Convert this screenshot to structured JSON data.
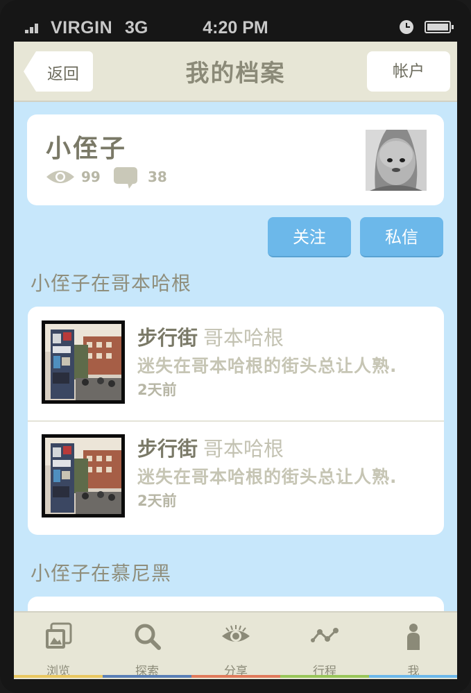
{
  "status_bar": {
    "carrier": "VIRGIN",
    "network": "3G",
    "time": "4:20 PM"
  },
  "nav": {
    "back_label": "返回",
    "title": "我的档案",
    "account_label": "帐户"
  },
  "profile": {
    "name": "小侄子",
    "views": "99",
    "comments": "38"
  },
  "actions": {
    "follow_label": "关注",
    "message_label": "私信"
  },
  "sections": [
    {
      "title": "小侄子在哥本哈根",
      "items": [
        {
          "street": "步行街",
          "city": "哥本哈根",
          "description": "迷失在哥本哈根的街头总让人熟.",
          "time_ago": "2天前"
        },
        {
          "street": "步行街",
          "city": "哥本哈根",
          "description": "迷失在哥本哈根的街头总让人熟.",
          "time_ago": "2天前"
        }
      ]
    },
    {
      "title": "小侄子在慕尼黑",
      "items": []
    }
  ],
  "tabs": [
    {
      "label": "浏览",
      "icon": "photos-icon",
      "color": "#e9c760"
    },
    {
      "label": "探索",
      "icon": "search-icon",
      "color": "#5a7fb6"
    },
    {
      "label": "分享",
      "icon": "eye-icon",
      "color": "#e07a5b"
    },
    {
      "label": "行程",
      "icon": "route-icon",
      "color": "#98c559"
    },
    {
      "label": "我",
      "icon": "person-icon",
      "color": "#6cb8ea"
    }
  ],
  "colors": {
    "background": "#c7e7fb",
    "bar": "#e7e6d6",
    "accent_button": "#6cb8ea"
  }
}
